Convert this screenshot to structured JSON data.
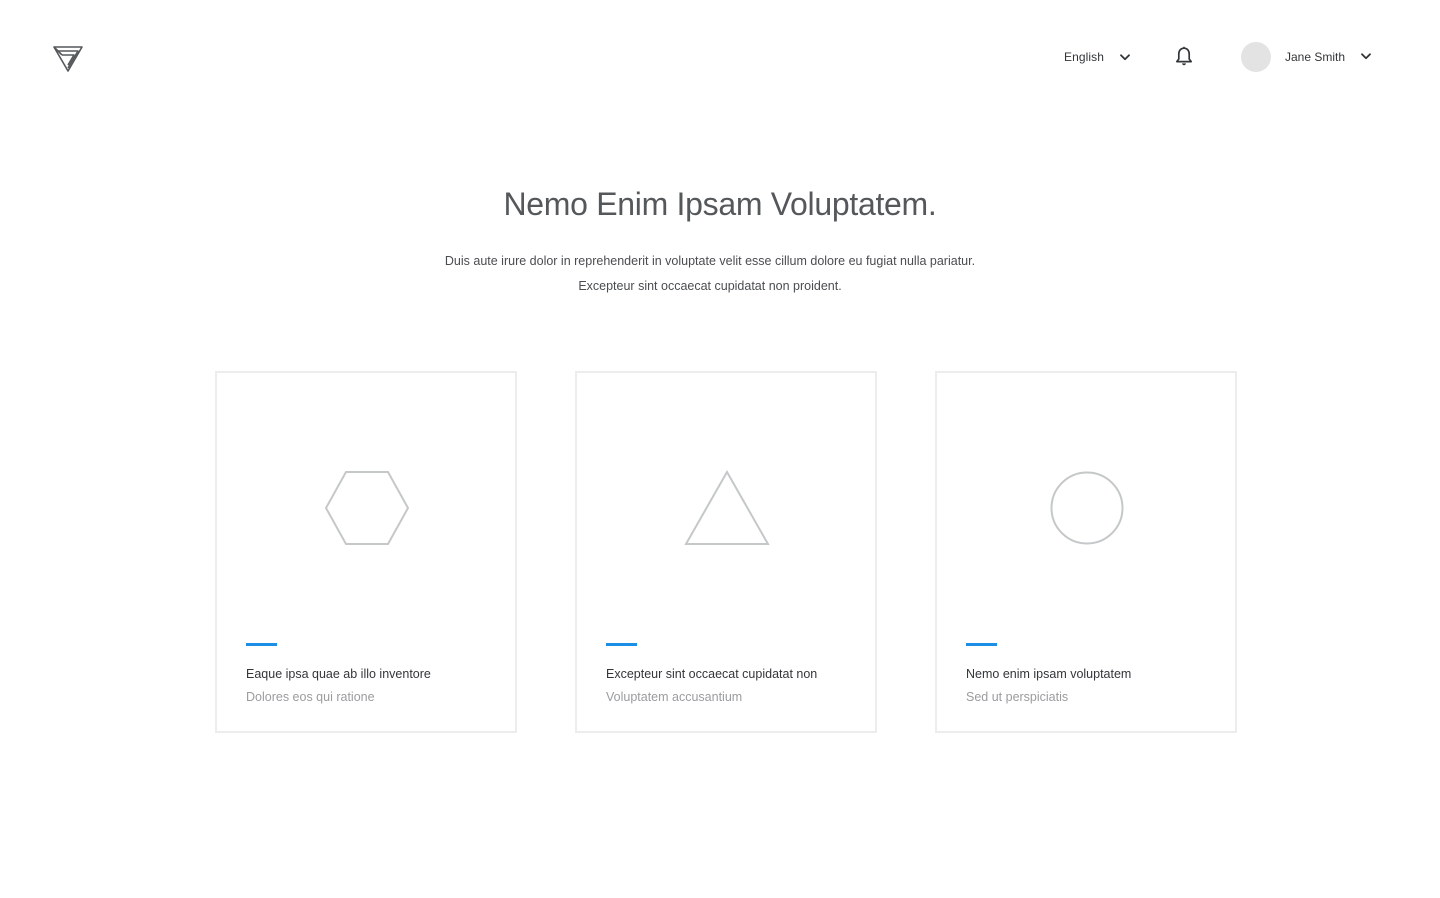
{
  "header": {
    "logo_icon": "triangle-knot-logo-icon",
    "language": {
      "label": "English",
      "icon": "chevron-down-icon"
    },
    "notifications": {
      "icon": "bell-icon"
    },
    "user": {
      "name": "Jane Smith",
      "avatar_color": "#e3e3e4",
      "icon": "chevron-down-icon"
    }
  },
  "hero": {
    "title": "Nemo Enim Ipsam Voluptatem.",
    "subtitle_line1": "Duis aute irure dolor in reprehenderit in voluptate velit esse cillum dolore eu fugiat nulla pariatur.",
    "subtitle_line2": "Excepteur sint occaecat cupidatat non proident."
  },
  "cards": [
    {
      "shape": "hexagon-icon",
      "title": "Eaque ipsa quae ab illo inventore",
      "subtitle": "Dolores eos qui ratione"
    },
    {
      "shape": "triangle-icon",
      "title": "Excepteur sint occaecat cupidatat non",
      "subtitle": "Voluptatem accusantium"
    },
    {
      "shape": "circle-icon",
      "title": "Nemo enim ipsam voluptatem",
      "subtitle": "Sed ut perspiciatis"
    }
  ],
  "colors": {
    "accent": "#1b8ee6",
    "card_border": "#eceded",
    "shape_stroke": "#c5c8c9",
    "text_dark": "#333639",
    "text_muted": "#9a9c9e"
  }
}
